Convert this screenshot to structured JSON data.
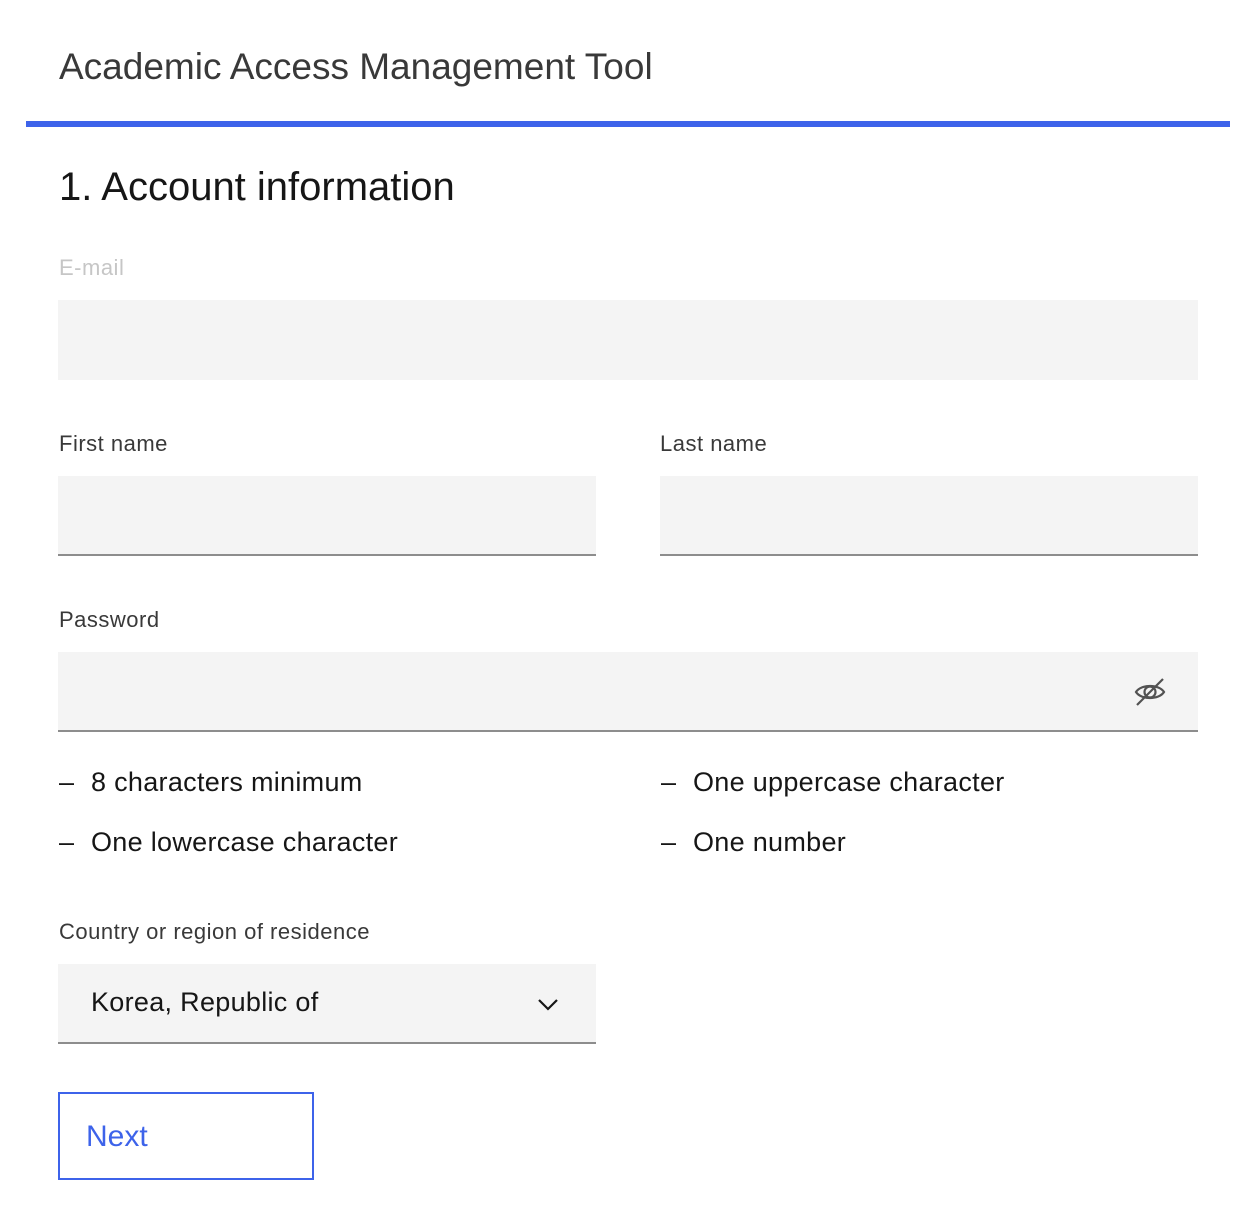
{
  "app": {
    "title": "Academic Access Management Tool",
    "accent_color": "#3d63ea"
  },
  "form": {
    "section_heading": "1. Account information",
    "email": {
      "label": "E-mail",
      "value": "",
      "disabled": true
    },
    "first_name": {
      "label": "First name",
      "value": ""
    },
    "last_name": {
      "label": "Last name",
      "value": ""
    },
    "password": {
      "label": "Password",
      "value": "",
      "toggle_icon": "eye-off-icon"
    },
    "password_requirements": [
      {
        "dash": "–",
        "text": "8 characters minimum"
      },
      {
        "dash": "–",
        "text": "One uppercase character"
      },
      {
        "dash": "–",
        "text": "One lowercase character"
      },
      {
        "dash": "–",
        "text": "One number"
      }
    ],
    "country": {
      "label": "Country or region of residence",
      "selected": "Korea, Republic of",
      "icon": "chevron-down-icon"
    },
    "next_button": {
      "label": "Next"
    }
  }
}
